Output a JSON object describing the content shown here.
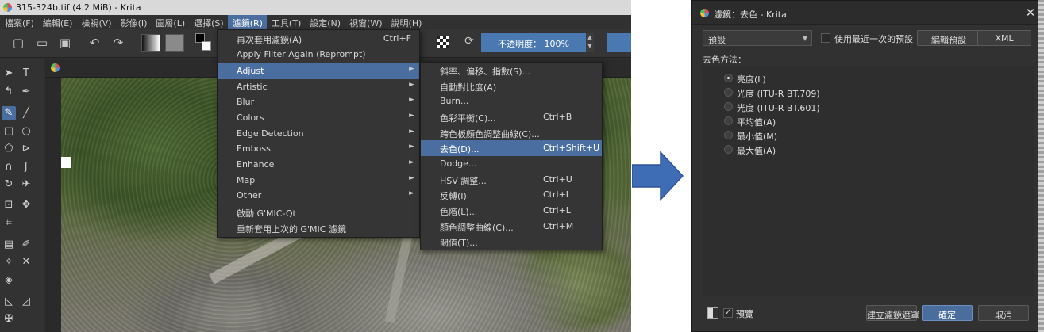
{
  "left_window": {
    "title": "315-324b.tif (4.2 MiB)  - Krita",
    "menubar": [
      {
        "label": "檔案(F)"
      },
      {
        "label": "編輯(E)"
      },
      {
        "label": "檢視(V)"
      },
      {
        "label": "影像(I)"
      },
      {
        "label": "圖層(L)"
      },
      {
        "label": "選擇(S)"
      },
      {
        "label": "濾鏡(R)"
      },
      {
        "label": "工具(T)"
      },
      {
        "label": "設定(N)"
      },
      {
        "label": "視窗(W)"
      },
      {
        "label": "說明(H)"
      }
    ],
    "opacity": "不透明度： 100%",
    "filter_menu": [
      {
        "label": "再次套用濾鏡(A)",
        "shortcut": "Ctrl+F"
      },
      {
        "label": "Apply Filter Again (Reprompt)",
        "shortcut": ""
      },
      {
        "label": "Adjust",
        "shortcut": ""
      },
      {
        "label": "Artistic",
        "shortcut": ""
      },
      {
        "label": "Blur",
        "shortcut": ""
      },
      {
        "label": "Colors",
        "shortcut": ""
      },
      {
        "label": "Edge Detection",
        "shortcut": ""
      },
      {
        "label": "Emboss",
        "shortcut": ""
      },
      {
        "label": "Enhance",
        "shortcut": ""
      },
      {
        "label": "Map",
        "shortcut": ""
      },
      {
        "label": "Other",
        "shortcut": ""
      },
      {
        "label": "啟動 G'MIC-Qt",
        "shortcut": ""
      },
      {
        "label": "重新套用上次的 G'MIC 濾鏡",
        "shortcut": ""
      }
    ],
    "adjust_submenu": [
      {
        "label": "斜率、偏移、指數(S)...",
        "shortcut": ""
      },
      {
        "label": "自動對比度(A)",
        "shortcut": ""
      },
      {
        "label": "Burn...",
        "shortcut": ""
      },
      {
        "label": "色彩平衡(C)...",
        "shortcut": "Ctrl+B"
      },
      {
        "label": "跨色板顏色調整曲線(C)...",
        "shortcut": ""
      },
      {
        "label": "去色(D)...",
        "shortcut": "Ctrl+Shift+U"
      },
      {
        "label": "Dodge...",
        "shortcut": ""
      },
      {
        "label": "HSV 調整...",
        "shortcut": "Ctrl+U"
      },
      {
        "label": "反轉(I)",
        "shortcut": "Ctrl+I"
      },
      {
        "label": "色階(L)...",
        "shortcut": "Ctrl+L"
      },
      {
        "label": "顏色調整曲線(C)...",
        "shortcut": "Ctrl+M"
      },
      {
        "label": "閾值(T)...",
        "shortcut": ""
      }
    ]
  },
  "dialog": {
    "title": "濾鏡：去色 - Krita",
    "preset_value": "預設",
    "use_last_preset_label": "使用最近一次的預設",
    "edit_preset_label": "編輯預設",
    "xml_label": "XML",
    "method_label": "去色方法：",
    "methods": [
      {
        "label": "亮度(L)",
        "checked": true
      },
      {
        "label": "光度 (ITU-R BT.709)",
        "checked": false
      },
      {
        "label": "光度 (ITU-R BT.601)",
        "checked": false
      },
      {
        "label": "平均值(A)",
        "checked": false
      },
      {
        "label": "最小值(M)",
        "checked": false
      },
      {
        "label": "最大值(A)",
        "checked": false
      }
    ],
    "preview_label": "預覽",
    "create_mask_label": "建立濾鏡遮罩",
    "ok_label": "確定",
    "cancel_label": "取消"
  },
  "colors": {
    "accent": "#4b6ea0",
    "arrow": "#3f6db5"
  }
}
